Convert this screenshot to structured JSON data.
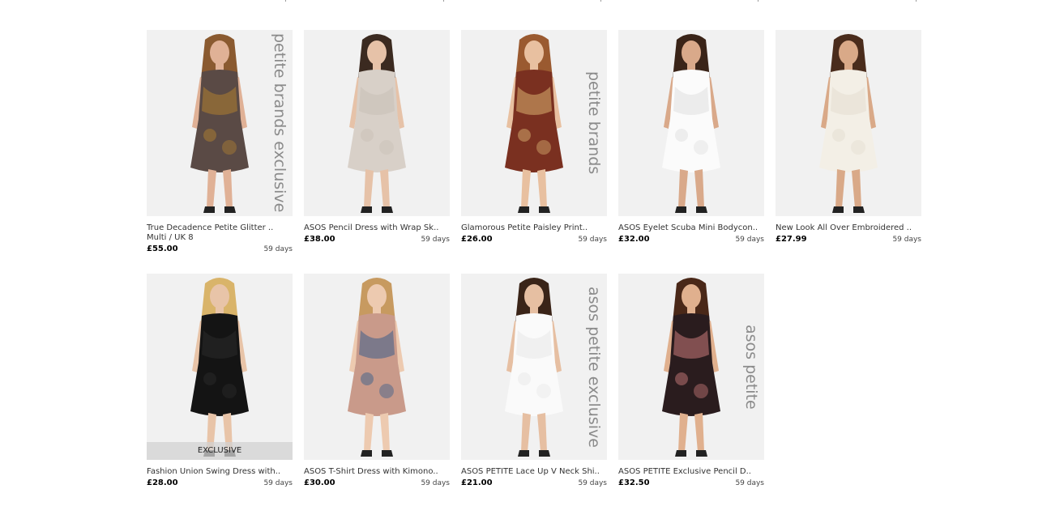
{
  "products": [
    [
      {
        "title": "True Decadence Petite Glitter ..",
        "variant": "Multi / UK 8",
        "price": "£55.00",
        "age": "59 days",
        "brand_text": "petite brands exclusive",
        "dress_color": "#5a4a45",
        "accent_color": "#b08030",
        "hair_color": "#8a5a30",
        "skin_color": "#e0b196"
      },
      {
        "title": "ASOS Pencil Dress with Wrap Sk..",
        "price": "£38.00",
        "age": "59 days",
        "dress_color": "#d8d0c8",
        "accent_color": "#c9c0b6",
        "hair_color": "#3b2a20",
        "skin_color": "#e6c2a8"
      },
      {
        "title": "Glamorous Petite Paisley Print..",
        "price": "£26.00",
        "age": "59 days",
        "brand_text": "petite brands",
        "dress_color": "#7a3020",
        "accent_color": "#d8b070",
        "hair_color": "#9a5a30",
        "skin_color": "#e8c0a0"
      },
      {
        "title": "ASOS Eyelet Scuba Mini Bodycon..",
        "price": "£32.00",
        "age": "59 days",
        "dress_color": "#fbfbfb",
        "accent_color": "#e0e0e0",
        "hair_color": "#3a2418",
        "skin_color": "#d9a98a"
      },
      {
        "title": "New Look All Over Embroidered ..",
        "price": "£27.99",
        "age": "59 days",
        "dress_color": "#f3efe6",
        "accent_color": "#e4ddd0",
        "hair_color": "#4a2c1c",
        "skin_color": "#d9a988"
      }
    ],
    [
      {
        "title": "Fashion Union Swing Dress with..",
        "price": "£28.00",
        "age": "59 days",
        "badge": "EXCLUSIVE",
        "dress_color": "#141414",
        "accent_color": "#2a2a2a",
        "hair_color": "#d9b46a",
        "skin_color": "#e8c4a8"
      },
      {
        "title": "ASOS T-Shirt Dress with Kimono..",
        "price": "£30.00",
        "age": "59 days",
        "dress_color": "#c99a8a",
        "accent_color": "#3c5f8a",
        "hair_color": "#c79a60",
        "skin_color": "#edcab0"
      },
      {
        "title": "ASOS PETITE Lace Up V Neck Shi..",
        "price": "£21.00",
        "age": "59 days",
        "brand_text": "asos petite exclusive",
        "dress_color": "#fafafa",
        "accent_color": "#e8e8e8",
        "hair_color": "#3a2418",
        "skin_color": "#e6bfa2"
      },
      {
        "title": "ASOS PETITE Exclusive Pencil D..",
        "price": "£32.50",
        "age": "59 days",
        "brand_text": "asos petite",
        "dress_color": "#2a1c1e",
        "accent_color": "#c87a7a",
        "hair_color": "#4a2818",
        "skin_color": "#e0b08e"
      }
    ]
  ]
}
